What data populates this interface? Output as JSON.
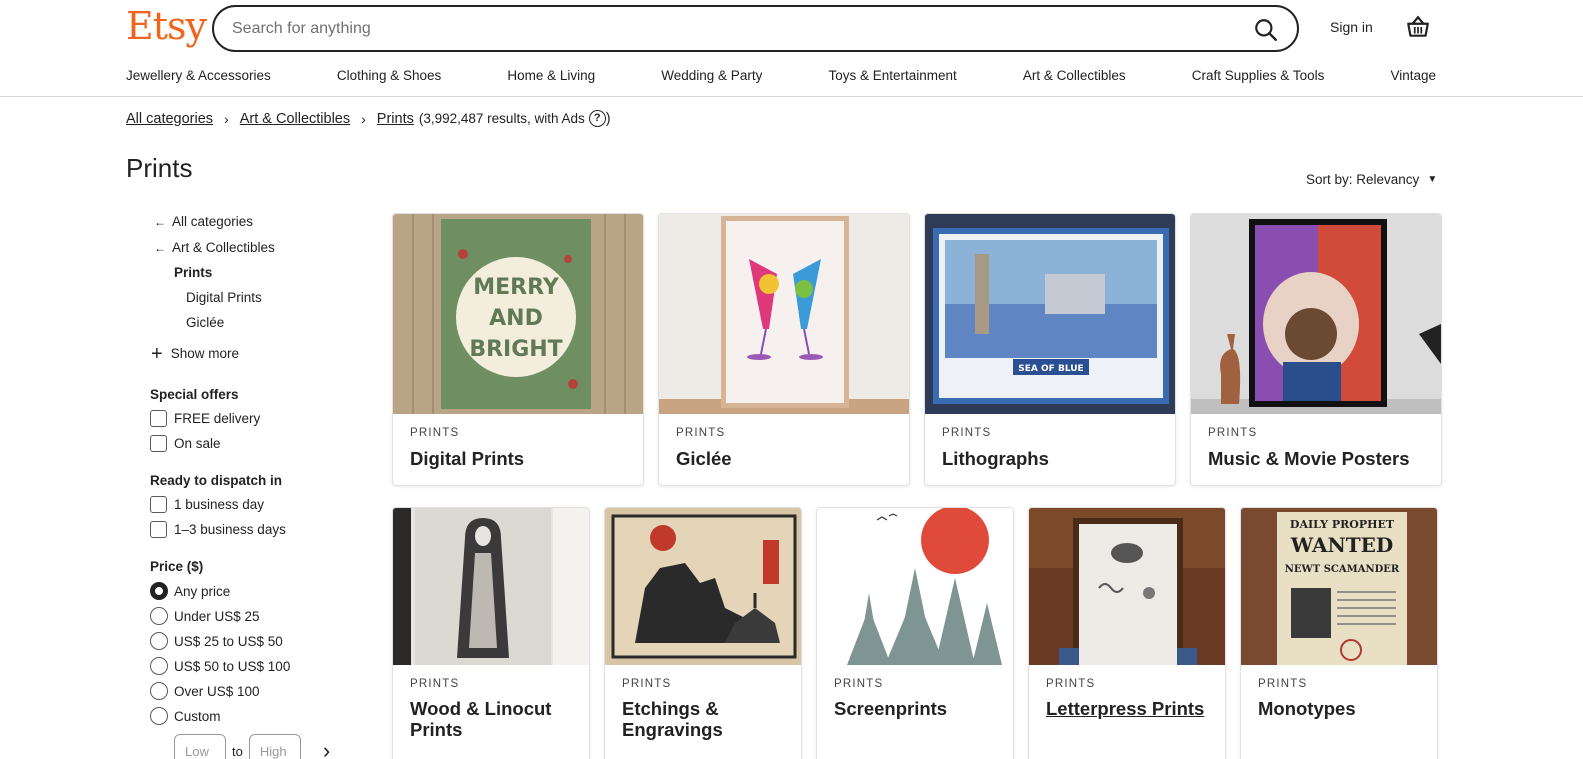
{
  "header": {
    "logo": "Etsy",
    "search_placeholder": "Search for anything",
    "sign_in": "Sign in",
    "icons": [
      "search-icon",
      "basket-icon"
    ]
  },
  "nav": [
    "Jewellery & Accessories",
    "Clothing & Shoes",
    "Home & Living",
    "Wedding & Party",
    "Toys & Entertainment",
    "Art & Collectibles",
    "Craft Supplies & Tools",
    "Vintage"
  ],
  "breadcrumb": {
    "items": [
      "All categories",
      "Art & Collectibles",
      "Prints"
    ],
    "results": "(3,992,487 results, with Ads",
    "help_glyph": "?",
    "close_paren": ")"
  },
  "page_title": "Prints",
  "sort": {
    "label": "Sort by: Relevancy"
  },
  "sidebar": {
    "all_categories": "All categories",
    "parent": "Art & Collectibles",
    "current": "Prints",
    "children": [
      "Digital Prints",
      "Giclée"
    ],
    "show_more": "Show more",
    "special_offers": {
      "title": "Special offers",
      "options": [
        "FREE delivery",
        "On sale"
      ]
    },
    "dispatch": {
      "title": "Ready to dispatch in",
      "options": [
        "1 business day",
        "1–3 business days"
      ]
    },
    "price": {
      "title": "Price ($)",
      "options": [
        "Any price",
        "Under US$ 25",
        "US$ 25 to US$ 50",
        "US$ 50 to US$ 100",
        "Over US$ 100",
        "Custom"
      ],
      "selected": "Any price",
      "low_placeholder": "Low",
      "to": "to",
      "high_placeholder": "High"
    }
  },
  "cards_row1": [
    {
      "kind": "PRINTS",
      "name": "Digital Prints",
      "art_text": [
        "MERRY",
        "AND",
        "BRIGHT"
      ]
    },
    {
      "kind": "PRINTS",
      "name": "Giclée"
    },
    {
      "kind": "PRINTS",
      "name": "Lithographs",
      "art_text": [
        "SEA OF BLUE"
      ]
    },
    {
      "kind": "PRINTS",
      "name": "Music & Movie Posters"
    }
  ],
  "cards_row2": [
    {
      "kind": "PRINTS",
      "name": "Wood & Linocut Prints"
    },
    {
      "kind": "PRINTS",
      "name": "Etchings & Engravings"
    },
    {
      "kind": "PRINTS",
      "name": "Screenprints"
    },
    {
      "kind": "PRINTS",
      "name": "Letterpress Prints"
    },
    {
      "kind": "PRINTS",
      "name": "Monotypes",
      "art_text": [
        "DAILY PROPHET",
        "WANTED",
        "NEWT SCAMANDER"
      ]
    }
  ],
  "colors": {
    "brand": "#F1641E",
    "text": "#222222",
    "border": "#e1e1e1"
  }
}
